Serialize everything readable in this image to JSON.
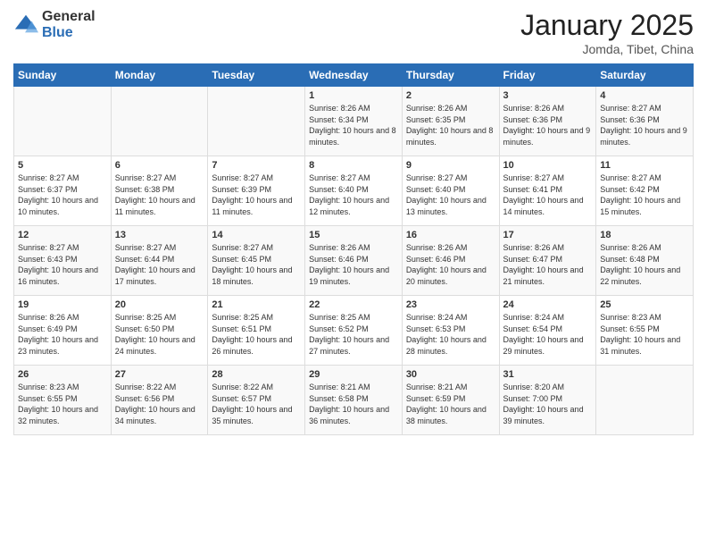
{
  "logo": {
    "general": "General",
    "blue": "Blue"
  },
  "header": {
    "month": "January 2025",
    "location": "Jomda, Tibet, China"
  },
  "days_of_week": [
    "Sunday",
    "Monday",
    "Tuesday",
    "Wednesday",
    "Thursday",
    "Friday",
    "Saturday"
  ],
  "weeks": [
    [
      {
        "day": "",
        "info": ""
      },
      {
        "day": "",
        "info": ""
      },
      {
        "day": "",
        "info": ""
      },
      {
        "day": "1",
        "info": "Sunrise: 8:26 AM\nSunset: 6:34 PM\nDaylight: 10 hours\nand 8 minutes."
      },
      {
        "day": "2",
        "info": "Sunrise: 8:26 AM\nSunset: 6:35 PM\nDaylight: 10 hours\nand 8 minutes."
      },
      {
        "day": "3",
        "info": "Sunrise: 8:26 AM\nSunset: 6:36 PM\nDaylight: 10 hours\nand 9 minutes."
      },
      {
        "day": "4",
        "info": "Sunrise: 8:27 AM\nSunset: 6:36 PM\nDaylight: 10 hours\nand 9 minutes."
      }
    ],
    [
      {
        "day": "5",
        "info": "Sunrise: 8:27 AM\nSunset: 6:37 PM\nDaylight: 10 hours\nand 10 minutes."
      },
      {
        "day": "6",
        "info": "Sunrise: 8:27 AM\nSunset: 6:38 PM\nDaylight: 10 hours\nand 11 minutes."
      },
      {
        "day": "7",
        "info": "Sunrise: 8:27 AM\nSunset: 6:39 PM\nDaylight: 10 hours\nand 11 minutes."
      },
      {
        "day": "8",
        "info": "Sunrise: 8:27 AM\nSunset: 6:40 PM\nDaylight: 10 hours\nand 12 minutes."
      },
      {
        "day": "9",
        "info": "Sunrise: 8:27 AM\nSunset: 6:40 PM\nDaylight: 10 hours\nand 13 minutes."
      },
      {
        "day": "10",
        "info": "Sunrise: 8:27 AM\nSunset: 6:41 PM\nDaylight: 10 hours\nand 14 minutes."
      },
      {
        "day": "11",
        "info": "Sunrise: 8:27 AM\nSunset: 6:42 PM\nDaylight: 10 hours\nand 15 minutes."
      }
    ],
    [
      {
        "day": "12",
        "info": "Sunrise: 8:27 AM\nSunset: 6:43 PM\nDaylight: 10 hours\nand 16 minutes."
      },
      {
        "day": "13",
        "info": "Sunrise: 8:27 AM\nSunset: 6:44 PM\nDaylight: 10 hours\nand 17 minutes."
      },
      {
        "day": "14",
        "info": "Sunrise: 8:27 AM\nSunset: 6:45 PM\nDaylight: 10 hours\nand 18 minutes."
      },
      {
        "day": "15",
        "info": "Sunrise: 8:26 AM\nSunset: 6:46 PM\nDaylight: 10 hours\nand 19 minutes."
      },
      {
        "day": "16",
        "info": "Sunrise: 8:26 AM\nSunset: 6:46 PM\nDaylight: 10 hours\nand 20 minutes."
      },
      {
        "day": "17",
        "info": "Sunrise: 8:26 AM\nSunset: 6:47 PM\nDaylight: 10 hours\nand 21 minutes."
      },
      {
        "day": "18",
        "info": "Sunrise: 8:26 AM\nSunset: 6:48 PM\nDaylight: 10 hours\nand 22 minutes."
      }
    ],
    [
      {
        "day": "19",
        "info": "Sunrise: 8:26 AM\nSunset: 6:49 PM\nDaylight: 10 hours\nand 23 minutes."
      },
      {
        "day": "20",
        "info": "Sunrise: 8:25 AM\nSunset: 6:50 PM\nDaylight: 10 hours\nand 24 minutes."
      },
      {
        "day": "21",
        "info": "Sunrise: 8:25 AM\nSunset: 6:51 PM\nDaylight: 10 hours\nand 26 minutes."
      },
      {
        "day": "22",
        "info": "Sunrise: 8:25 AM\nSunset: 6:52 PM\nDaylight: 10 hours\nand 27 minutes."
      },
      {
        "day": "23",
        "info": "Sunrise: 8:24 AM\nSunset: 6:53 PM\nDaylight: 10 hours\nand 28 minutes."
      },
      {
        "day": "24",
        "info": "Sunrise: 8:24 AM\nSunset: 6:54 PM\nDaylight: 10 hours\nand 29 minutes."
      },
      {
        "day": "25",
        "info": "Sunrise: 8:23 AM\nSunset: 6:55 PM\nDaylight: 10 hours\nand 31 minutes."
      }
    ],
    [
      {
        "day": "26",
        "info": "Sunrise: 8:23 AM\nSunset: 6:55 PM\nDaylight: 10 hours\nand 32 minutes."
      },
      {
        "day": "27",
        "info": "Sunrise: 8:22 AM\nSunset: 6:56 PM\nDaylight: 10 hours\nand 34 minutes."
      },
      {
        "day": "28",
        "info": "Sunrise: 8:22 AM\nSunset: 6:57 PM\nDaylight: 10 hours\nand 35 minutes."
      },
      {
        "day": "29",
        "info": "Sunrise: 8:21 AM\nSunset: 6:58 PM\nDaylight: 10 hours\nand 36 minutes."
      },
      {
        "day": "30",
        "info": "Sunrise: 8:21 AM\nSunset: 6:59 PM\nDaylight: 10 hours\nand 38 minutes."
      },
      {
        "day": "31",
        "info": "Sunrise: 8:20 AM\nSunset: 7:00 PM\nDaylight: 10 hours\nand 39 minutes."
      },
      {
        "day": "",
        "info": ""
      }
    ]
  ]
}
